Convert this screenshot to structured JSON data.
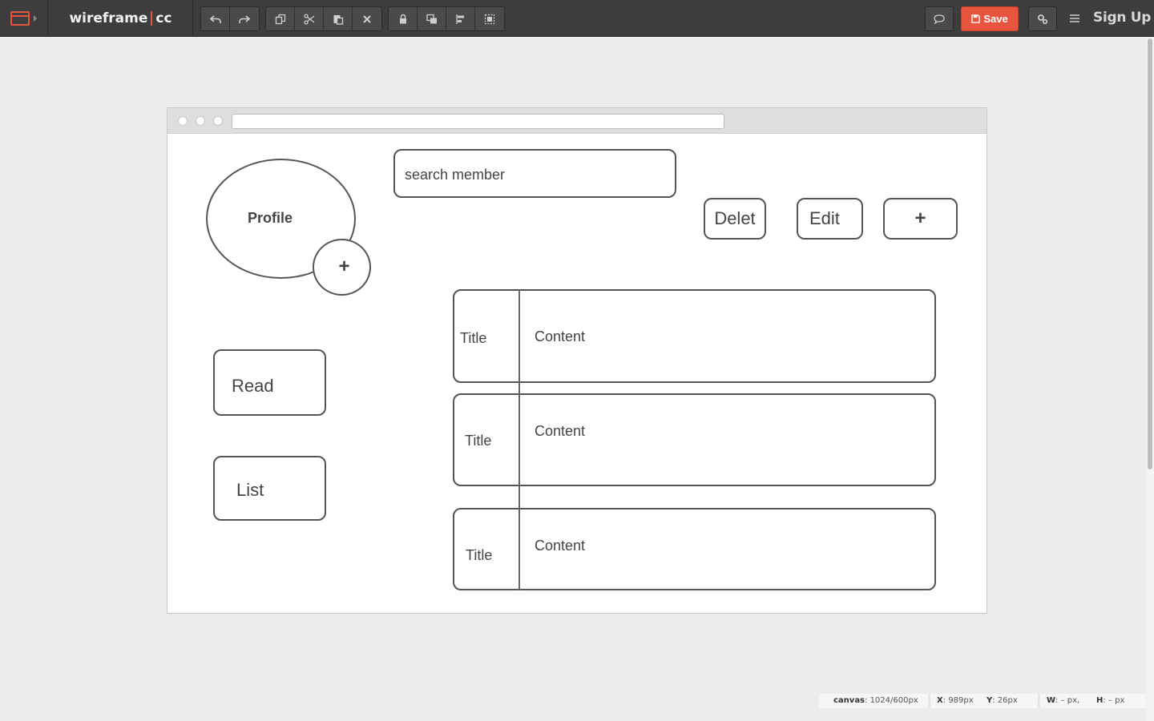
{
  "app": {
    "logo_left": "wireframe",
    "logo_right": "cc",
    "save_label": "Save",
    "signup_label": "Sign Up"
  },
  "toolbar": {
    "history": [
      "undo-icon",
      "redo-icon"
    ],
    "edit": [
      "copy-icon",
      "cut-icon",
      "paste-icon",
      "delete-icon"
    ],
    "arrange": [
      "lock-icon",
      "bring-front-icon",
      "align-icon",
      "group-icon"
    ],
    "right": [
      "comment-icon",
      "settings-icon",
      "menu-icon"
    ]
  },
  "colors": {
    "toolbar_bg": "#3d3d3d",
    "accent": "#e8553f",
    "canvas_bg": "#ececec",
    "stroke": "#555555"
  },
  "wireframe": {
    "search_placeholder": "search member",
    "profile_label": "Profile",
    "profile_add": "+",
    "delete_label": "Delet",
    "edit_label": "Edit",
    "add_label": "+",
    "read_label": "Read",
    "list_label": "List",
    "cards": [
      {
        "title": "Title",
        "content": "Content"
      },
      {
        "title": "Title",
        "content": "Content"
      },
      {
        "title": "Title",
        "content": "Content"
      }
    ]
  },
  "status": {
    "canvas_label": "canvas",
    "canvas_value": ": 1024/600px",
    "x_label": "X",
    "x_value": ": 989px",
    "y_label": "Y",
    "y_value": ": 26px",
    "w_label": "W",
    "w_value": ": – px,",
    "h_label": "H",
    "h_value": ": – px"
  }
}
